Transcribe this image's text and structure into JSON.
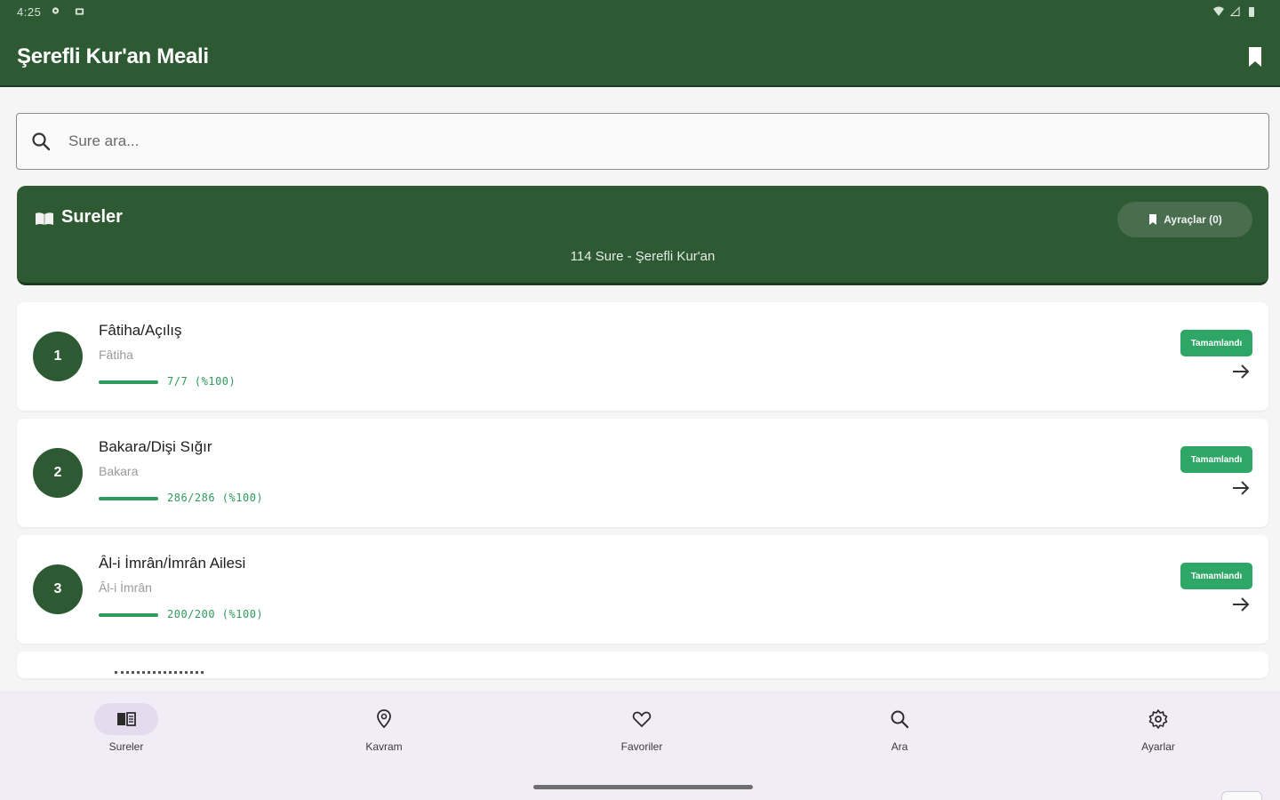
{
  "statusbar": {
    "time": "4:25"
  },
  "appbar": {
    "title": "Şerefli Kur'an Meali"
  },
  "search": {
    "placeholder": "Sure ara..."
  },
  "hero": {
    "icon": "book-emoji-icon",
    "title": "Sureler",
    "subtitle": "114 Sure - Şerefli Kur'an",
    "bookmarks_button": "Ayraçlar (0)"
  },
  "surahs": [
    {
      "number": "1",
      "name": "Fâtiha/Açılış",
      "arabic": "Fâtiha",
      "progress_text": "7/7 (%100)",
      "progress": 1.0,
      "status": "Tamamlandı"
    },
    {
      "number": "2",
      "name": "Bakara/Dişi Sığır",
      "arabic": "Bakara",
      "progress_text": "286/286 (%100)",
      "progress": 1.0,
      "status": "Tamamlandı"
    },
    {
      "number": "3",
      "name": "Âl-i İmrân/İmrân Ailesi",
      "arabic": "Âl-i İmrân",
      "progress_text": "200/200 (%100)",
      "progress": 1.0,
      "status": "Tamamlandı"
    }
  ],
  "nav": [
    {
      "label": "Sureler",
      "icon": "book-open-icon",
      "active": true
    },
    {
      "label": "Kavram",
      "icon": "location-pin-icon",
      "active": false
    },
    {
      "label": "Favoriler",
      "icon": "heart-icon",
      "active": false
    },
    {
      "label": "Ara",
      "icon": "search-icon",
      "active": false
    },
    {
      "label": "Ayarlar",
      "icon": "gear-icon",
      "active": false
    }
  ],
  "colors": {
    "primary": "#2e5a33",
    "accent_green": "#2ea766",
    "nav_bg": "#f2ecf7"
  }
}
